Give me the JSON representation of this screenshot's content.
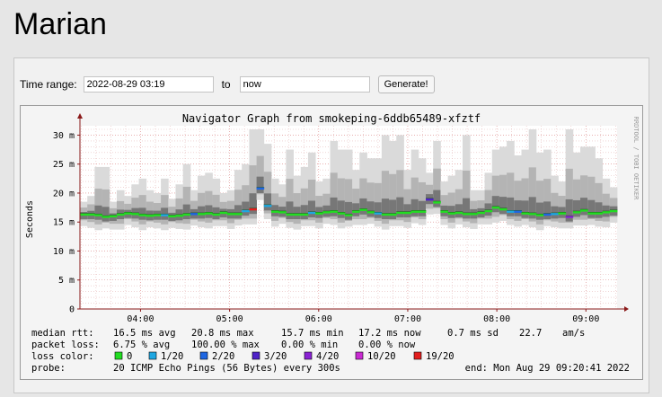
{
  "page": {
    "title": "Marian"
  },
  "form": {
    "time_range_label": "Time range:",
    "start_value": "2022-08-29 03:19",
    "to_label": "to",
    "end_value": "now",
    "generate_label": "Generate!"
  },
  "chart_data": {
    "type": "area",
    "title": "Navigator Graph from smokeping-6ddb65489-xfztf",
    "ylabel": "Seconds",
    "xlabel": "",
    "side_text": "RRDTOOL / TOBI OETIKER",
    "y_ticks": [
      "0",
      "5 m",
      "10 m",
      "15 m",
      "20 m",
      "25 m",
      "30 m"
    ],
    "y_tick_values_ms": [
      0,
      5,
      10,
      15,
      20,
      25,
      30
    ],
    "ylim_ms": [
      0,
      31
    ],
    "x_ticks": [
      "04:00",
      "05:00",
      "06:00",
      "07:00",
      "08:00",
      "09:00"
    ],
    "x_tick_hours": [
      4,
      5,
      6,
      7,
      8,
      9
    ],
    "xlim_hours": [
      3.32,
      9.35
    ],
    "grid": true,
    "series": [
      {
        "name": "median rtt",
        "median_ms": [
          16.3,
          16.3,
          16.2,
          15.9,
          16.0,
          16.3,
          16.5,
          16.4,
          16.2,
          16.1,
          16.2,
          16.2,
          16.0,
          16.1,
          16.3,
          16.4,
          16.4,
          16.5,
          16.3,
          16.6,
          16.4,
          16.4,
          16.9,
          17.2,
          20.8,
          17.8,
          16.8,
          16.7,
          16.3,
          16.3,
          16.3,
          16.6,
          16.5,
          16.7,
          16.8,
          16.5,
          16.2,
          16.8,
          17.1,
          16.7,
          16.5,
          16.3,
          16.3,
          16.6,
          16.6,
          16.8,
          16.8,
          18.9,
          18.4,
          16.8,
          16.5,
          16.6,
          16.4,
          16.4,
          16.6,
          16.9,
          17.5,
          17.2,
          16.8,
          16.8,
          16.5,
          16.4,
          16.2,
          16.3,
          16.4,
          16.5,
          15.9,
          16.7,
          17.0,
          16.5,
          16.5,
          16.7,
          16.9
        ],
        "max_ms": [
          18.5,
          19.5,
          24.5,
          24.5,
          18.5,
          20.5,
          19.5,
          21.5,
          22.5,
          20.5,
          20.0,
          22.5,
          19.0,
          21.5,
          25.0,
          20.5,
          23.0,
          23.5,
          22.5,
          20.0,
          20.5,
          24.0,
          25.0,
          31.0,
          31.0,
          28.5,
          22.5,
          21.5,
          27.5,
          23.0,
          24.5,
          27.0,
          22.0,
          22.5,
          29.0,
          27.5,
          27.5,
          24.0,
          27.0,
          26.0,
          26.0,
          30.0,
          29.0,
          30.0,
          24.0,
          27.5,
          26.0,
          23.5,
          29.0,
          22.0,
          23.0,
          24.0,
          30.0,
          20.5,
          20.5,
          23.5,
          27.5,
          28.0,
          29.0,
          26.5,
          27.5,
          31.0,
          27.0,
          27.5,
          23.0,
          22.0,
          31.0,
          27.0,
          28.0,
          28.0,
          26.0,
          22.5,
          21.0
        ],
        "loss_count": [
          0,
          0,
          0,
          0,
          0,
          0,
          0,
          0,
          0,
          0,
          0,
          1,
          0,
          0,
          0,
          2,
          0,
          0,
          0,
          0,
          0,
          0,
          1,
          19,
          2,
          1,
          0,
          0,
          0,
          0,
          0,
          1,
          0,
          0,
          0,
          0,
          0,
          0,
          0,
          0,
          1,
          0,
          0,
          0,
          0,
          0,
          0,
          3,
          0,
          0,
          0,
          0,
          0,
          0,
          0,
          0,
          0,
          0,
          1,
          2,
          0,
          0,
          0,
          2,
          1,
          0,
          4,
          0,
          0,
          0,
          0,
          0,
          0
        ]
      }
    ],
    "loss_colors": [
      {
        "label": "0",
        "color": "#22dd22"
      },
      {
        "label": "1/20",
        "color": "#1ea7e2"
      },
      {
        "label": "2/20",
        "color": "#1e66e2"
      },
      {
        "label": "3/20",
        "color": "#4f22c8"
      },
      {
        "label": "4/20",
        "color": "#8a22d4"
      },
      {
        "label": "10/20",
        "color": "#c92ad2"
      },
      {
        "label": "19/20",
        "color": "#e21e1e"
      }
    ],
    "summary": {
      "rtt_label": "median rtt:",
      "rtt_avg": "16.5 ms avg",
      "rtt_max": "20.8 ms max",
      "rtt_min": "15.7 ms min",
      "rtt_now": "17.2 ms now",
      "rtt_sd": "0.7 ms sd",
      "rtt_ams": "22.7",
      "rtt_ams_unit": "am/s",
      "loss_label": "packet loss:",
      "loss_avg": "6.75 % avg",
      "loss_max": "100.00 % max",
      "loss_min": "0.00 % min",
      "loss_now": "0.00 % now",
      "loss_color_label": "loss color:",
      "probe_label": "probe:",
      "probe_value": "20 ICMP Echo Pings (56 Bytes) every 300s",
      "end_value": "end: Mon Aug 29 09:20:41 2022"
    },
    "colors": {
      "grid_minor": "#e6bcbc",
      "grid_major": "#d98080",
      "axis": "#8a1a1a",
      "text": "#000000"
    }
  }
}
